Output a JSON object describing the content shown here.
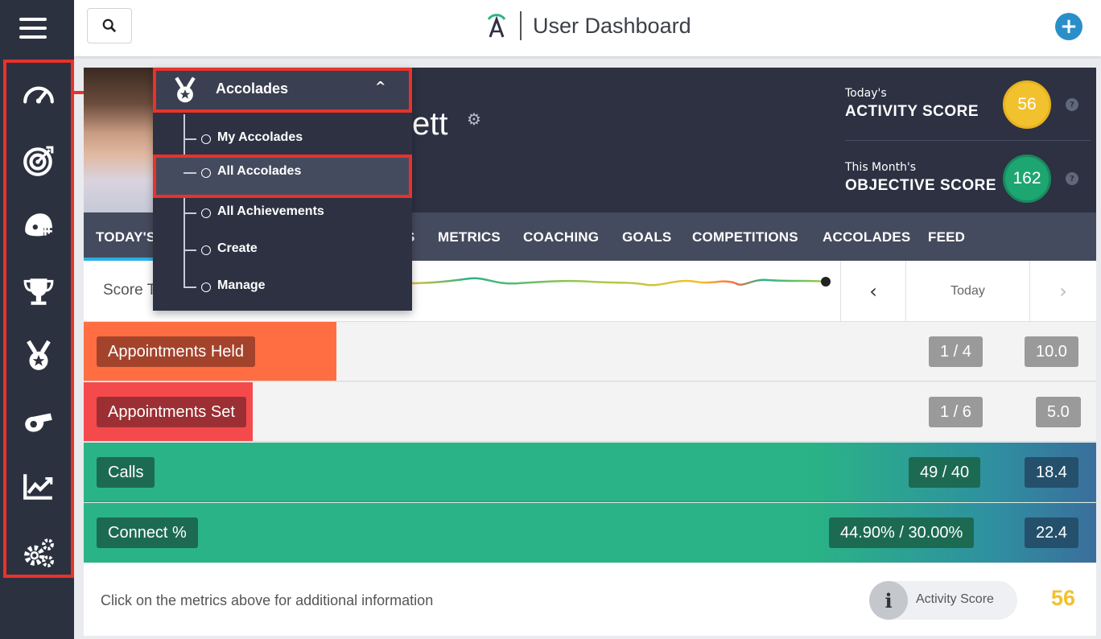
{
  "app": {
    "title": "User Dashboard"
  },
  "sidebar": {
    "items": [
      {
        "name": "dashboard-icon"
      },
      {
        "name": "target-icon"
      },
      {
        "name": "helmet-icon"
      },
      {
        "name": "trophy-icon"
      },
      {
        "name": "medal-icon"
      },
      {
        "name": "whistle-icon"
      },
      {
        "name": "chart-icon"
      },
      {
        "name": "gears-icon"
      }
    ]
  },
  "profile": {
    "name_fragment": "ett",
    "activity": {
      "sub": "Today's",
      "main": "ACTIVITY SCORE",
      "value": "56",
      "color": "#f2c12e",
      "help": "?"
    },
    "objective": {
      "sub": "This Month's",
      "main": "OBJECTIVE SCORE",
      "value": "162",
      "color": "#1ea672",
      "help": "?"
    }
  },
  "tabs": [
    {
      "label": "TODAY'S",
      "active": true
    },
    {
      "label": "S",
      "active": false
    },
    {
      "label": "METRICS",
      "active": false
    },
    {
      "label": "COACHING",
      "active": false
    },
    {
      "label": "GOALS",
      "active": false
    },
    {
      "label": "COMPETITIONS",
      "active": false
    },
    {
      "label": "ACCOLADES",
      "active": false
    },
    {
      "label": "FEED",
      "active": false
    }
  ],
  "trend": {
    "label_fragment": "Score T",
    "date_label": "Today",
    "prev": "‹",
    "next": "›"
  },
  "metrics": [
    {
      "label": "Appointments Held",
      "ratio": "1 / 4",
      "points": "10.0",
      "fill_fraction": 0.25,
      "fill_color": "#ff6e42",
      "label_bg": "#a4432c"
    },
    {
      "label": "Appointments Set",
      "ratio": "1 / 6",
      "points": "5.0",
      "fill_fraction": 0.167,
      "fill_color": "#f44a4c",
      "label_bg": "#9b2f33"
    },
    {
      "label": "Calls",
      "ratio": "49 / 40",
      "points": "18.4",
      "fill_fraction": 1.0,
      "fill_color": "#2ab386",
      "label_bg": "#1d6a52"
    },
    {
      "label": "Connect %",
      "ratio": "44.90% / 30.00%",
      "points": "22.4",
      "fill_fraction": 1.0,
      "fill_color": "#2ab386",
      "label_bg": "#1d6a52"
    }
  ],
  "footer": {
    "hint": "Click on the metrics above for additional information",
    "pill_icon": "i",
    "pill_label": "Activity Score",
    "score": "56"
  },
  "dropdown": {
    "header": "Accolades",
    "items": [
      {
        "label": "My Accolades",
        "selected": false
      },
      {
        "label": "All Accolades",
        "selected": true
      },
      {
        "label": "All Achievements",
        "selected": false
      },
      {
        "label": "Create",
        "selected": false
      },
      {
        "label": "Manage",
        "selected": false
      }
    ]
  },
  "colors": {
    "sidebar": "#2c3140",
    "highlight": "#e8322b",
    "accent": "#2a8fc8"
  }
}
